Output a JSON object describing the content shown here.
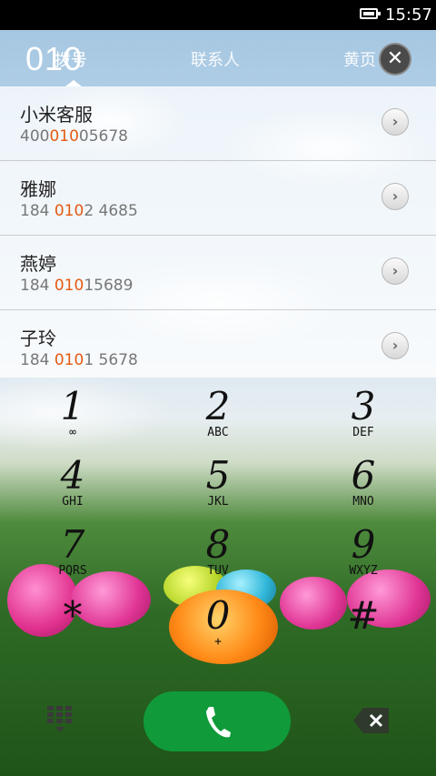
{
  "status_bar": {
    "time": "15:57",
    "battery_icon": "battery-icon"
  },
  "dial_input": "010",
  "tabs": [
    {
      "label": "拨号",
      "active": true
    },
    {
      "label": "联系人",
      "active": false
    },
    {
      "label": "黄页",
      "active": false
    }
  ],
  "close_icon": "close-icon",
  "contacts": [
    {
      "name": "小米客服",
      "number_pre": "400",
      "number_match": "010",
      "number_post": "05678"
    },
    {
      "name": "雅娜",
      "number_pre": "184 ",
      "number_match": "010",
      "number_post": "2 4685"
    },
    {
      "name": "燕婷",
      "number_pre": "184 ",
      "number_match": "010",
      "number_post": "15689"
    },
    {
      "name": "子玲",
      "number_pre": "184 ",
      "number_match": "010",
      "number_post": "1 5678"
    }
  ],
  "keypad": [
    {
      "digit": "1",
      "letters": "∞"
    },
    {
      "digit": "2",
      "letters": "ABC"
    },
    {
      "digit": "3",
      "letters": "DEF"
    },
    {
      "digit": "4",
      "letters": "GHI"
    },
    {
      "digit": "5",
      "letters": "JKL"
    },
    {
      "digit": "6",
      "letters": "MNO"
    },
    {
      "digit": "7",
      "letters": "PQRS"
    },
    {
      "digit": "8",
      "letters": "TUV"
    },
    {
      "digit": "9",
      "letters": "WXYZ"
    },
    {
      "digit": "*",
      "letters": ""
    },
    {
      "digit": "0",
      "letters": "+"
    },
    {
      "digit": "#",
      "letters": ""
    }
  ],
  "bottom_bar": {
    "keypad_toggle_icon": "keypad-grid-icon",
    "call_icon": "phone-icon",
    "backspace_icon": "backspace-icon"
  },
  "colors": {
    "highlight": "#e55a12",
    "call_button": "#109a3a"
  }
}
